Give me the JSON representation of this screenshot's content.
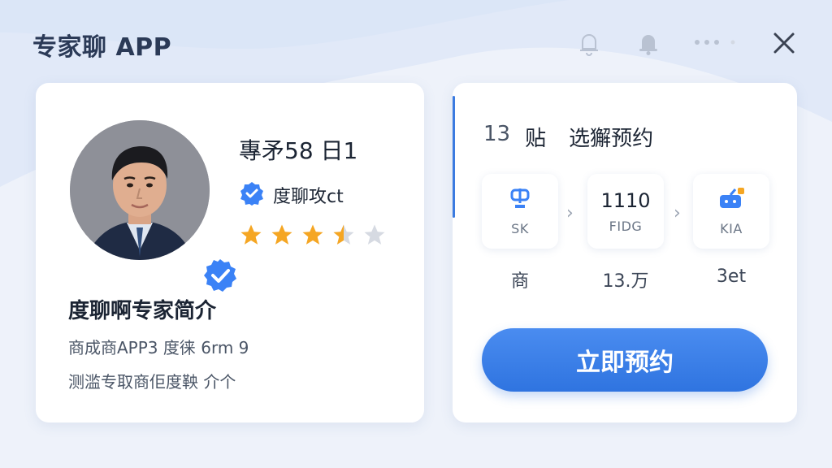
{
  "app": {
    "title": "专家聊 APP"
  },
  "header_icons": [
    "bell-outline-icon",
    "bell-filled-icon",
    "more-dots-icon",
    "close-icon"
  ],
  "profile": {
    "name": "專矛58 日1",
    "certification": "度聊攻ct",
    "rating": 3.5,
    "max_rating": 5,
    "intro_title": "度聊啊专家简介",
    "intro_lines": [
      "商成商APP3 度徕 6rm 9",
      "测滥专取商佢度鞅 介个"
    ]
  },
  "booking": {
    "title_prefix": "13",
    "title_mid": "贴",
    "title_main": "选獬预约",
    "steps": [
      {
        "code": "SK",
        "icon": "link-icon",
        "big": "",
        "label": "商"
      },
      {
        "code": "FIDG",
        "icon": "",
        "big": "1110",
        "label": "13.万"
      },
      {
        "code": "KIA",
        "icon": "device-notify-icon",
        "big": "",
        "label": "3et"
      }
    ],
    "cta_label": "立即预约"
  },
  "colors": {
    "accent": "#3b7be0",
    "star_filled": "#f5a623",
    "star_empty": "#d6dae2",
    "badge": "#3b82f6",
    "background": "#eef2fa"
  }
}
